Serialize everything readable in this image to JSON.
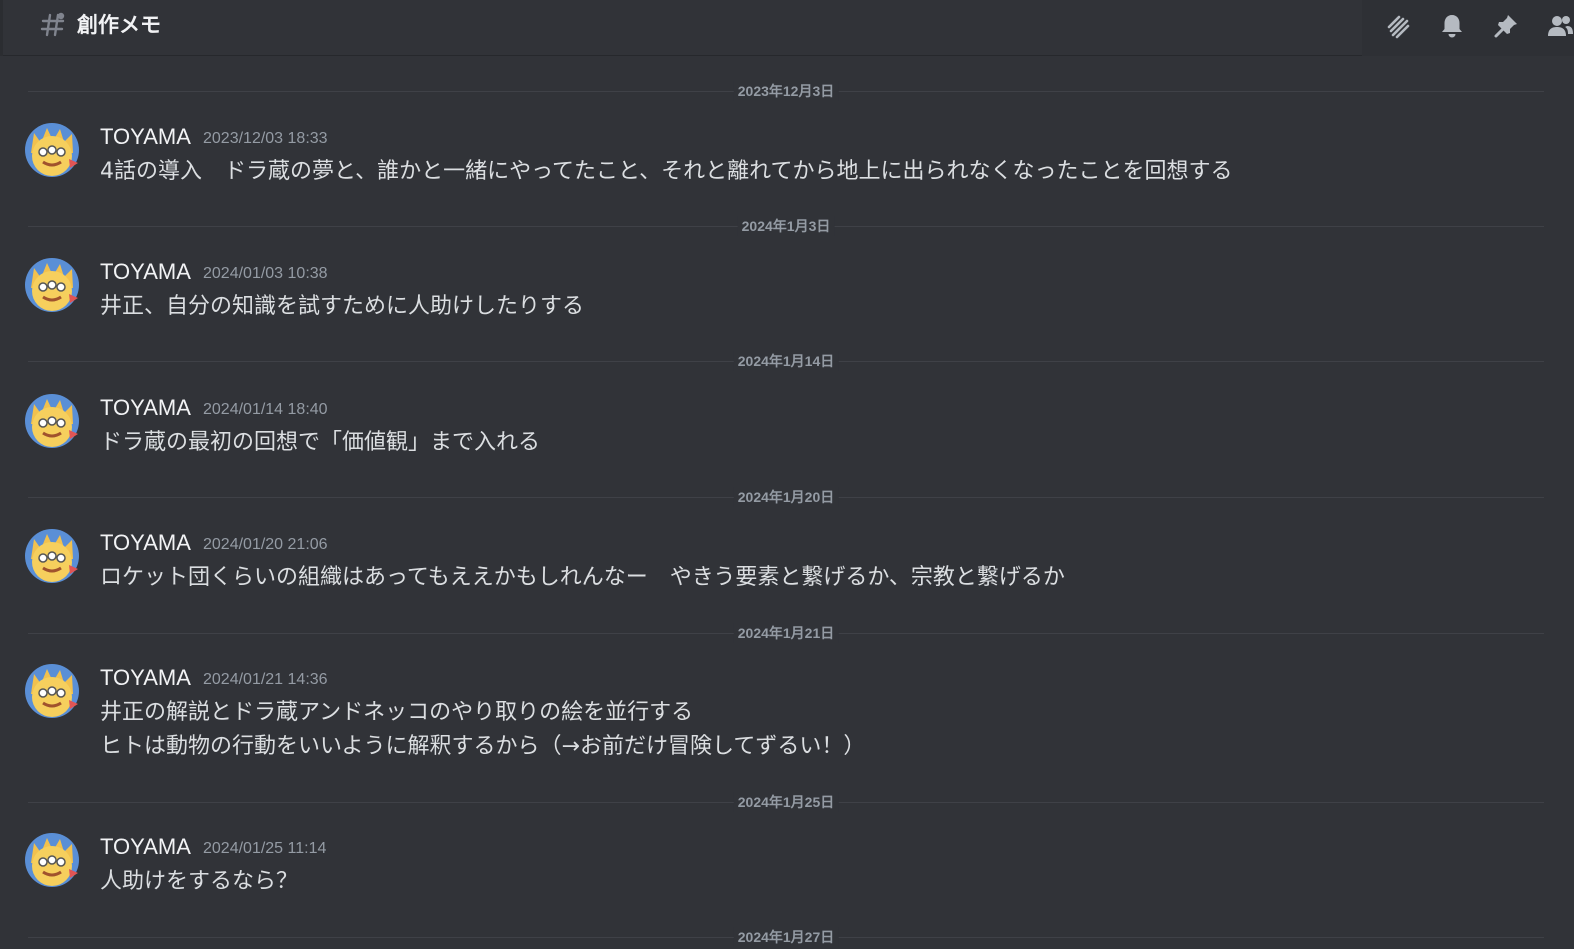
{
  "header": {
    "channel_name": "創作メモ",
    "icons": [
      "threads-icon",
      "bell-icon",
      "pin-icon",
      "members-icon"
    ]
  },
  "colors": {
    "background": "#313338",
    "username": "#f2f3f5",
    "timestamp": "#949ba4",
    "text": "#dbdee1"
  },
  "dates": [
    "2023年12月3日",
    "2024年1月3日",
    "2024年1月14日",
    "2024年1月20日",
    "2024年1月21日",
    "2024年1月25日",
    "2024年1月27日"
  ],
  "messages": [
    {
      "username": "TOYAMA",
      "timestamp": "2023/12/03 18:33",
      "lines": [
        "4話の導入　ドラ蔵の夢と、誰かと一緒にやってたこと、それと離れてから地上に出られなくなったことを回想する"
      ]
    },
    {
      "username": "TOYAMA",
      "timestamp": "2024/01/03 10:38",
      "lines": [
        "井正、自分の知識を試すために人助けしたりする"
      ]
    },
    {
      "username": "TOYAMA",
      "timestamp": "2024/01/14 18:40",
      "lines": [
        "ドラ蔵の最初の回想で「価値観」まで入れる"
      ]
    },
    {
      "username": "TOYAMA",
      "timestamp": "2024/01/20 21:06",
      "lines": [
        "ロケット団くらいの組織はあってもええかもしれんなー　やきう要素と繋げるか、宗教と繋げるか"
      ]
    },
    {
      "username": "TOYAMA",
      "timestamp": "2024/01/21 14:36",
      "lines": [
        "井正の解説とドラ蔵アンドネッコのやり取りの絵を並行する",
        "ヒトは動物の行動をいいように解釈するから（→お前だけ冒険してずるい！）"
      ]
    },
    {
      "username": "TOYAMA",
      "timestamp": "2024/01/25 11:14",
      "lines": [
        "人助けをするなら？"
      ]
    }
  ]
}
